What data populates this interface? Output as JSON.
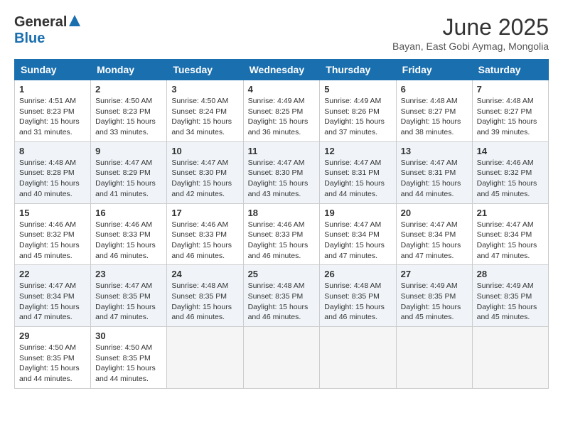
{
  "header": {
    "logo_general": "General",
    "logo_blue": "Blue",
    "month_title": "June 2025",
    "subtitle": "Bayan, East Gobi Aymag, Mongolia"
  },
  "days_of_week": [
    "Sunday",
    "Monday",
    "Tuesday",
    "Wednesday",
    "Thursday",
    "Friday",
    "Saturday"
  ],
  "weeks": [
    [
      {
        "day": "1",
        "sunrise": "Sunrise: 4:51 AM",
        "sunset": "Sunset: 8:23 PM",
        "daylight": "Daylight: 15 hours and 31 minutes."
      },
      {
        "day": "2",
        "sunrise": "Sunrise: 4:50 AM",
        "sunset": "Sunset: 8:23 PM",
        "daylight": "Daylight: 15 hours and 33 minutes."
      },
      {
        "day": "3",
        "sunrise": "Sunrise: 4:50 AM",
        "sunset": "Sunset: 8:24 PM",
        "daylight": "Daylight: 15 hours and 34 minutes."
      },
      {
        "day": "4",
        "sunrise": "Sunrise: 4:49 AM",
        "sunset": "Sunset: 8:25 PM",
        "daylight": "Daylight: 15 hours and 36 minutes."
      },
      {
        "day": "5",
        "sunrise": "Sunrise: 4:49 AM",
        "sunset": "Sunset: 8:26 PM",
        "daylight": "Daylight: 15 hours and 37 minutes."
      },
      {
        "day": "6",
        "sunrise": "Sunrise: 4:48 AM",
        "sunset": "Sunset: 8:27 PM",
        "daylight": "Daylight: 15 hours and 38 minutes."
      },
      {
        "day": "7",
        "sunrise": "Sunrise: 4:48 AM",
        "sunset": "Sunset: 8:27 PM",
        "daylight": "Daylight: 15 hours and 39 minutes."
      }
    ],
    [
      {
        "day": "8",
        "sunrise": "Sunrise: 4:48 AM",
        "sunset": "Sunset: 8:28 PM",
        "daylight": "Daylight: 15 hours and 40 minutes."
      },
      {
        "day": "9",
        "sunrise": "Sunrise: 4:47 AM",
        "sunset": "Sunset: 8:29 PM",
        "daylight": "Daylight: 15 hours and 41 minutes."
      },
      {
        "day": "10",
        "sunrise": "Sunrise: 4:47 AM",
        "sunset": "Sunset: 8:30 PM",
        "daylight": "Daylight: 15 hours and 42 minutes."
      },
      {
        "day": "11",
        "sunrise": "Sunrise: 4:47 AM",
        "sunset": "Sunset: 8:30 PM",
        "daylight": "Daylight: 15 hours and 43 minutes."
      },
      {
        "day": "12",
        "sunrise": "Sunrise: 4:47 AM",
        "sunset": "Sunset: 8:31 PM",
        "daylight": "Daylight: 15 hours and 44 minutes."
      },
      {
        "day": "13",
        "sunrise": "Sunrise: 4:47 AM",
        "sunset": "Sunset: 8:31 PM",
        "daylight": "Daylight: 15 hours and 44 minutes."
      },
      {
        "day": "14",
        "sunrise": "Sunrise: 4:46 AM",
        "sunset": "Sunset: 8:32 PM",
        "daylight": "Daylight: 15 hours and 45 minutes."
      }
    ],
    [
      {
        "day": "15",
        "sunrise": "Sunrise: 4:46 AM",
        "sunset": "Sunset: 8:32 PM",
        "daylight": "Daylight: 15 hours and 45 minutes."
      },
      {
        "day": "16",
        "sunrise": "Sunrise: 4:46 AM",
        "sunset": "Sunset: 8:33 PM",
        "daylight": "Daylight: 15 hours and 46 minutes."
      },
      {
        "day": "17",
        "sunrise": "Sunrise: 4:46 AM",
        "sunset": "Sunset: 8:33 PM",
        "daylight": "Daylight: 15 hours and 46 minutes."
      },
      {
        "day": "18",
        "sunrise": "Sunrise: 4:46 AM",
        "sunset": "Sunset: 8:33 PM",
        "daylight": "Daylight: 15 hours and 46 minutes."
      },
      {
        "day": "19",
        "sunrise": "Sunrise: 4:47 AM",
        "sunset": "Sunset: 8:34 PM",
        "daylight": "Daylight: 15 hours and 47 minutes."
      },
      {
        "day": "20",
        "sunrise": "Sunrise: 4:47 AM",
        "sunset": "Sunset: 8:34 PM",
        "daylight": "Daylight: 15 hours and 47 minutes."
      },
      {
        "day": "21",
        "sunrise": "Sunrise: 4:47 AM",
        "sunset": "Sunset: 8:34 PM",
        "daylight": "Daylight: 15 hours and 47 minutes."
      }
    ],
    [
      {
        "day": "22",
        "sunrise": "Sunrise: 4:47 AM",
        "sunset": "Sunset: 8:34 PM",
        "daylight": "Daylight: 15 hours and 47 minutes."
      },
      {
        "day": "23",
        "sunrise": "Sunrise: 4:47 AM",
        "sunset": "Sunset: 8:35 PM",
        "daylight": "Daylight: 15 hours and 47 minutes."
      },
      {
        "day": "24",
        "sunrise": "Sunrise: 4:48 AM",
        "sunset": "Sunset: 8:35 PM",
        "daylight": "Daylight: 15 hours and 46 minutes."
      },
      {
        "day": "25",
        "sunrise": "Sunrise: 4:48 AM",
        "sunset": "Sunset: 8:35 PM",
        "daylight": "Daylight: 15 hours and 46 minutes."
      },
      {
        "day": "26",
        "sunrise": "Sunrise: 4:48 AM",
        "sunset": "Sunset: 8:35 PM",
        "daylight": "Daylight: 15 hours and 46 minutes."
      },
      {
        "day": "27",
        "sunrise": "Sunrise: 4:49 AM",
        "sunset": "Sunset: 8:35 PM",
        "daylight": "Daylight: 15 hours and 45 minutes."
      },
      {
        "day": "28",
        "sunrise": "Sunrise: 4:49 AM",
        "sunset": "Sunset: 8:35 PM",
        "daylight": "Daylight: 15 hours and 45 minutes."
      }
    ],
    [
      {
        "day": "29",
        "sunrise": "Sunrise: 4:50 AM",
        "sunset": "Sunset: 8:35 PM",
        "daylight": "Daylight: 15 hours and 44 minutes."
      },
      {
        "day": "30",
        "sunrise": "Sunrise: 4:50 AM",
        "sunset": "Sunset: 8:35 PM",
        "daylight": "Daylight: 15 hours and 44 minutes."
      },
      null,
      null,
      null,
      null,
      null
    ]
  ]
}
